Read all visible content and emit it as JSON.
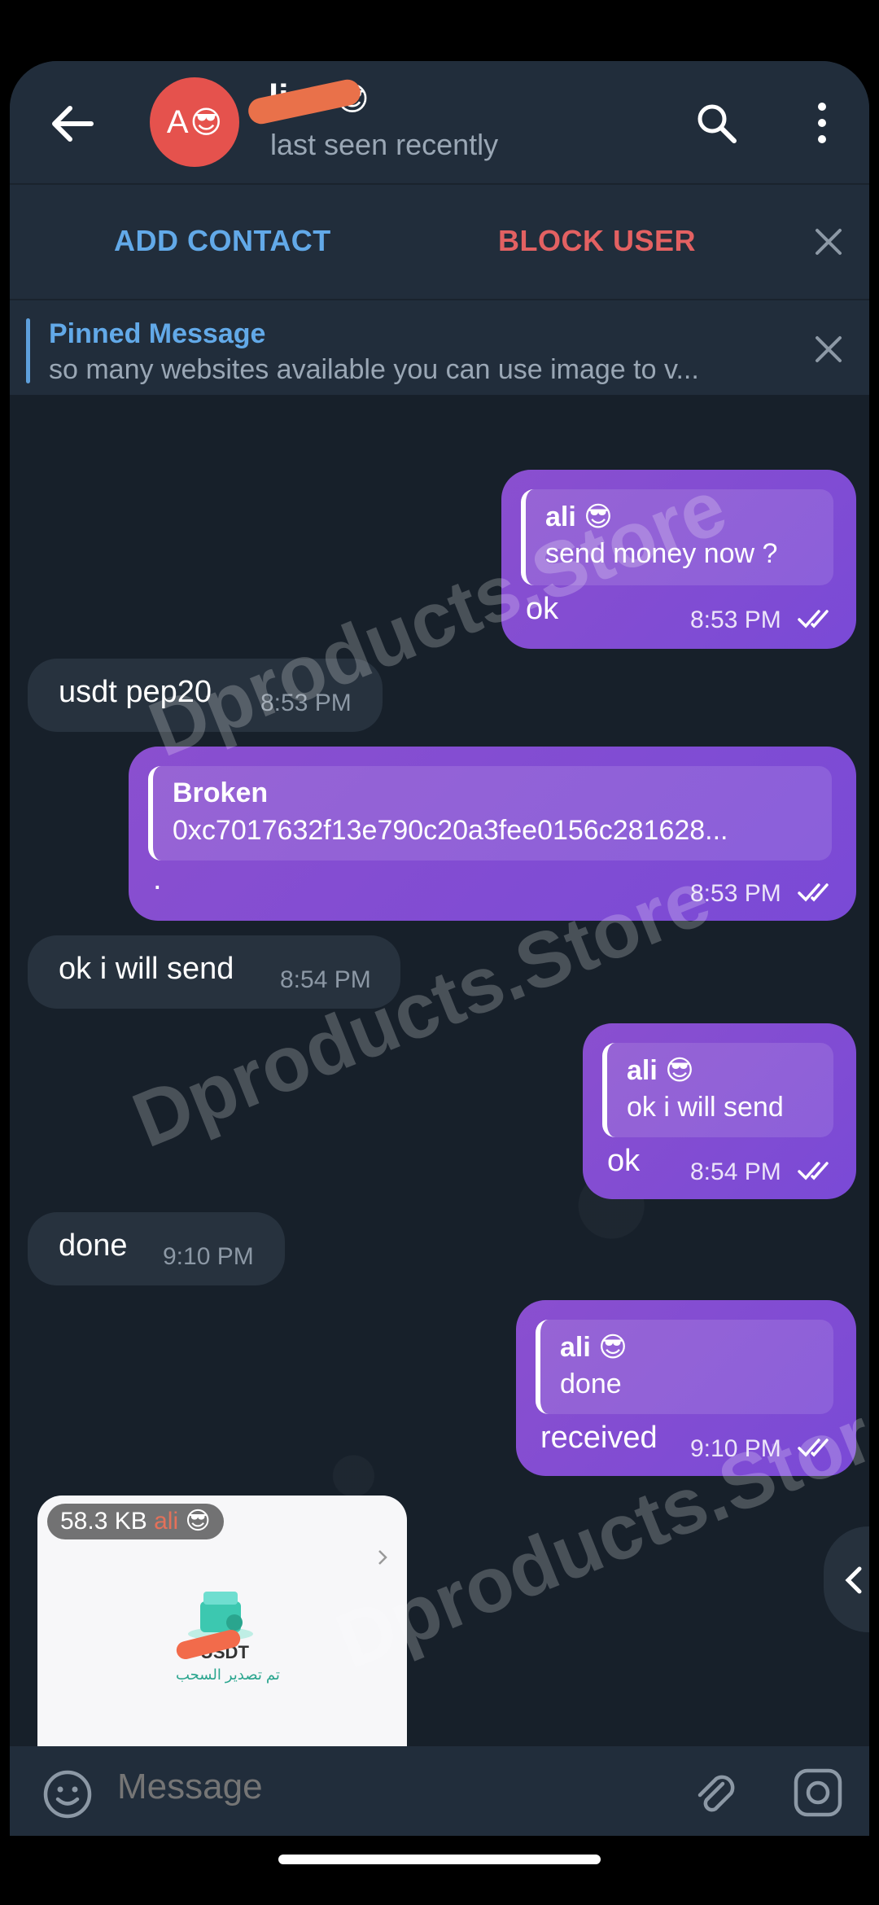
{
  "header": {
    "avatar_initial": "A",
    "avatar_emoji": "😎",
    "name_visible": "li",
    "name_emoji": "😎",
    "status": "last seen recently"
  },
  "actions": {
    "add_contact": "ADD CONTACT",
    "block_user": "BLOCK USER"
  },
  "pinned": {
    "title": "Pinned Message",
    "text": "so many websites available you can use image to v..."
  },
  "watermark": "Dproducts.Store",
  "messages": [
    {
      "dir": "out",
      "reply_name": "ali 😎",
      "reply_text": "send money now ?",
      "text": "ok",
      "time": "8:53 PM"
    },
    {
      "dir": "in",
      "text": "usdt pep20",
      "time": "8:53 PM"
    },
    {
      "dir": "out",
      "reply_name": "Broken",
      "reply_text": "0xc7017632f13e790c20a3fee0156c281628...",
      "text": ".",
      "time": "8:53 PM"
    },
    {
      "dir": "in",
      "text": "ok i will send",
      "time": "8:54 PM"
    },
    {
      "dir": "out",
      "reply_name": "ali 😎",
      "reply_text": "ok i will send",
      "text": "ok",
      "time": "8:54 PM"
    },
    {
      "dir": "in",
      "text": "done",
      "time": "9:10 PM"
    },
    {
      "dir": "out",
      "reply_name": "ali 😎",
      "reply_text": "done",
      "text": "received",
      "time": "9:10 PM"
    }
  ],
  "image_message": {
    "size": "58.3 KB",
    "sender": "ali",
    "sender_emoji": "😎",
    "usdt_label": "USDT",
    "arabic_caption": "تم تصدير السحب"
  },
  "input": {
    "placeholder": "Message"
  },
  "colors": {
    "outgoing_bubble": "#8a4fcf",
    "incoming_bubble": "#27323e",
    "accent_blue": "#62a9e8",
    "accent_red": "#e36162",
    "avatar": "#e5524d"
  },
  "icons": [
    "back-arrow-icon",
    "search-icon",
    "more-vert-icon",
    "close-icon",
    "emoji-icon",
    "attach-icon",
    "camera-icon",
    "double-check-icon",
    "chevron-left-icon"
  ]
}
